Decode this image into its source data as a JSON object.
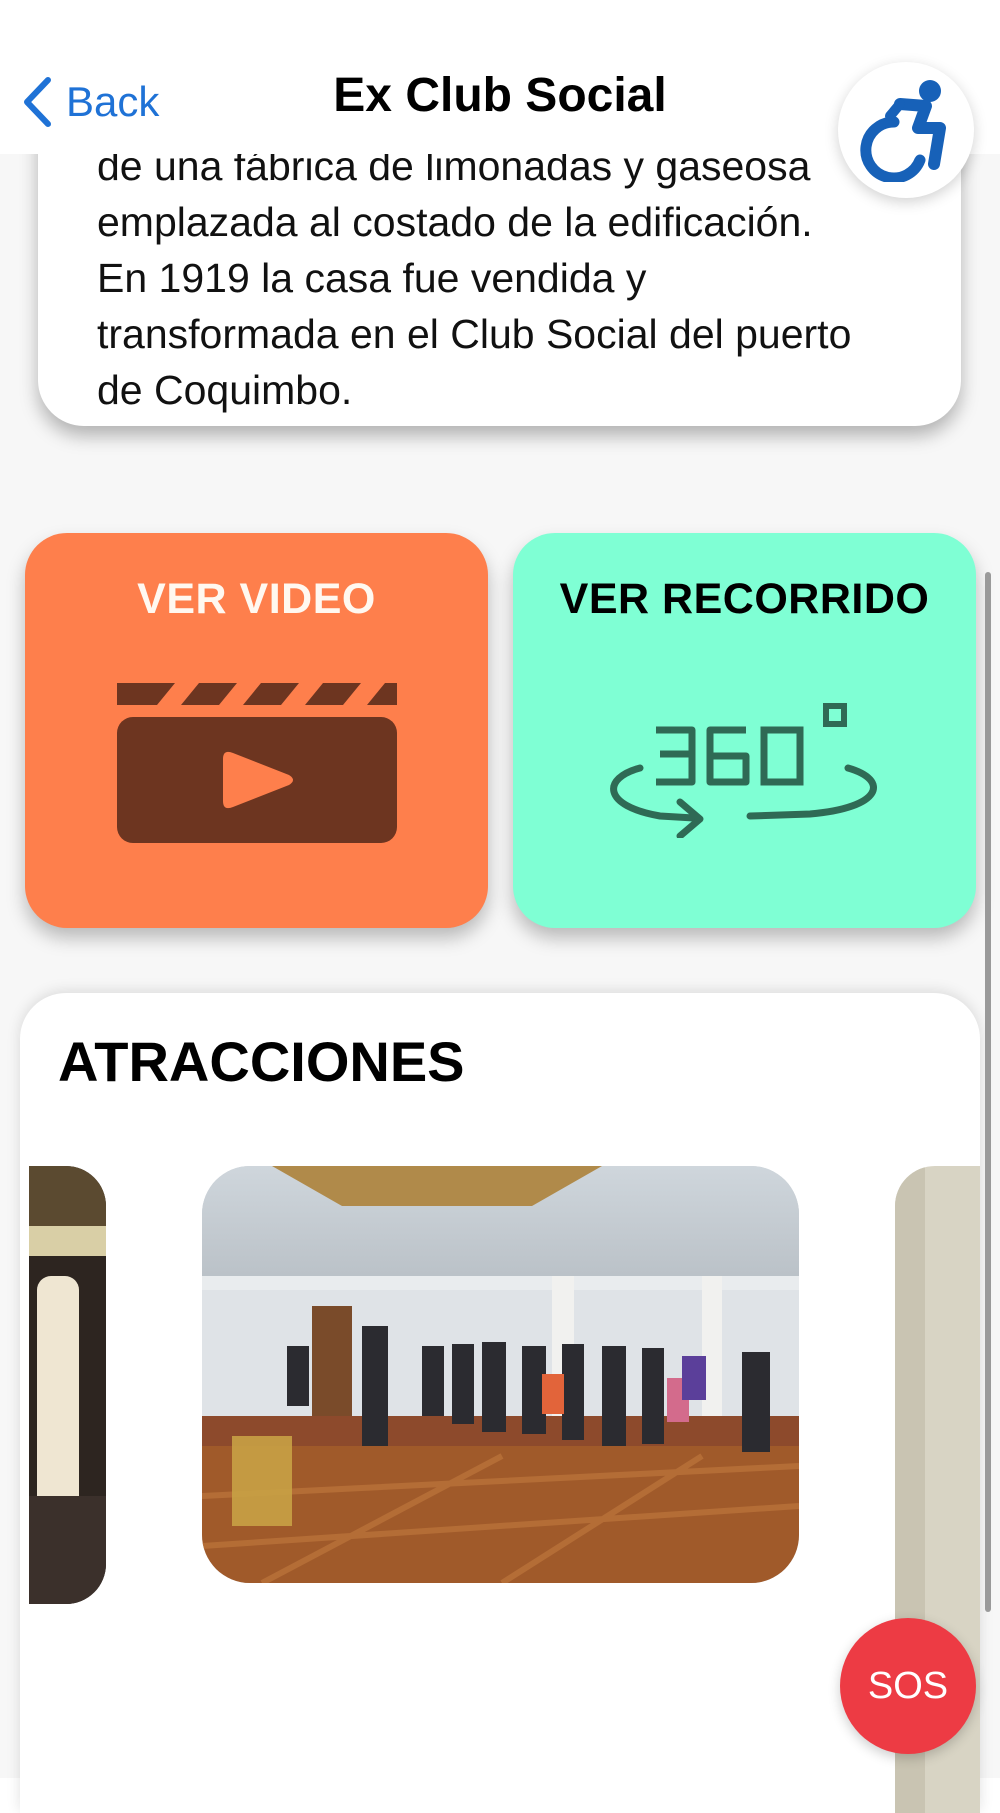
{
  "header": {
    "back_label": "Back",
    "title": "Ex Club Social",
    "accessibility_icon": "wheelchair-accessibility-icon"
  },
  "description": {
    "lines": [
      "de una fábrica de limonadas y gaseosa",
      "emplazada al costado de la edificación.",
      "En 1919 la casa fue vendida y",
      "transformada en el Club Social del puerto",
      "de Coquimbo."
    ]
  },
  "actions": {
    "video": {
      "label": "VER VIDEO",
      "icon": "clapperboard-play-icon",
      "color": "#fe7f4c"
    },
    "tour": {
      "label": "VER RECORRIDO",
      "icon": "360-view-icon",
      "color": "#7fffd4"
    }
  },
  "attractions": {
    "title": "ATRACCIONES"
  },
  "sos": {
    "label": "SOS",
    "color": "#ed3b44"
  },
  "colors": {
    "accent_blue": "#1f72d6",
    "icon_blue": "#1761b8"
  }
}
